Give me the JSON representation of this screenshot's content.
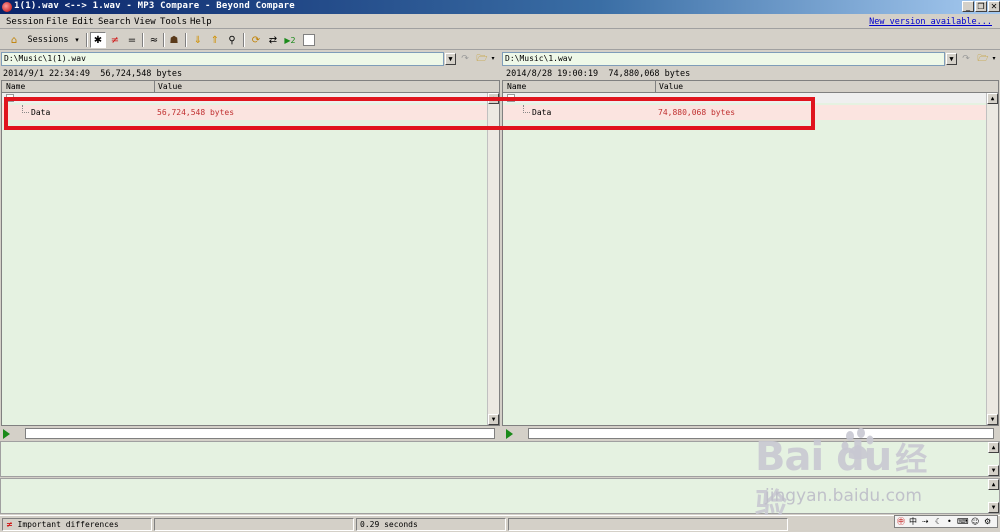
{
  "window": {
    "title": "1(1).wav <--> 1.wav - MP3 Compare - Beyond Compare",
    "min": "_",
    "max": "❐",
    "close": "✕"
  },
  "menu": {
    "items": [
      "Session",
      "File",
      "Edit",
      "Search",
      "View",
      "Tools",
      "Help"
    ],
    "new_version": "New version available..."
  },
  "toolbar": {
    "sessions_label": "Sessions",
    "all_glyph": "✱",
    "diffs_glyph": "≠",
    "same_glyph": "=",
    "similar_glyph": "≈"
  },
  "left": {
    "path": "D:\\Music\\1(1).wav",
    "date": "2014/9/1 22:34:49",
    "size": "56,724,548 bytes",
    "col_name": "Name",
    "col_value": "Value",
    "row_name": "Data",
    "row_value": "56,724,548 bytes"
  },
  "right": {
    "path": "D:\\Music\\1.wav",
    "date": "2014/8/28 19:00:19",
    "size": "74,880,068 bytes",
    "col_name": "Name",
    "col_value": "Value",
    "row_name": "Data",
    "row_value": "74,880,068 bytes"
  },
  "status": {
    "filter": "Important differences",
    "time": "0.29 seconds"
  },
  "watermark": {
    "brand": "Bai  du",
    "cn": "经验",
    "url": "jingyan.baidu.com"
  },
  "ime": {
    "label": "中"
  },
  "colors": {
    "diff_text": "#c03030",
    "highlight": "#e0141e",
    "pane_bg": "#e5f2e1"
  }
}
